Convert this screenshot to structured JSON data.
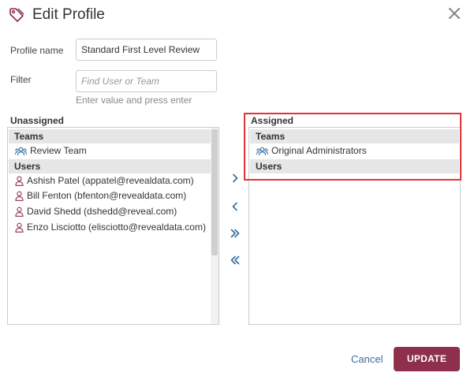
{
  "dialog": {
    "title": "Edit Profile",
    "icon": "tag-icon",
    "close_icon": "close-icon"
  },
  "form": {
    "profile_name_label": "Profile name",
    "profile_name_value": "Standard First Level Review",
    "filter_label": "Filter",
    "filter_placeholder": "Find User or Team",
    "filter_hint": "Enter value and press enter"
  },
  "unassigned": {
    "title": "Unassigned",
    "teams_header": "Teams",
    "teams": [
      {
        "label": "Review Team",
        "icon": "team-icon"
      }
    ],
    "users_header": "Users",
    "users": [
      {
        "label": "Ashish Patel (appatel@revealdata.com)",
        "icon": "user-icon"
      },
      {
        "label": "Bill Fenton (bfenton@revealdata.com)",
        "icon": "user-icon"
      },
      {
        "label": "David Shedd (dshedd@reveal.com)",
        "icon": "user-icon"
      },
      {
        "label": "Enzo Lisciotto (elisciotto@revealdata.com)",
        "icon": "user-icon"
      }
    ]
  },
  "assigned": {
    "title": "Assigned",
    "teams_header": "Teams",
    "teams": [
      {
        "label": "Original Administrators",
        "icon": "team-icon"
      }
    ],
    "users_header": "Users",
    "users": []
  },
  "move_buttons": [
    "move-right-icon",
    "move-left-icon",
    "move-all-right-icon",
    "move-all-left-icon"
  ],
  "footer": {
    "cancel_label": "Cancel",
    "update_label": "UPDATE"
  },
  "colors": {
    "accent": "#8e2f4c",
    "link": "#3b6aa0",
    "icon": "#2e6da4",
    "highlight": "#e0343a",
    "group_header_bg": "#e6e6e6"
  }
}
